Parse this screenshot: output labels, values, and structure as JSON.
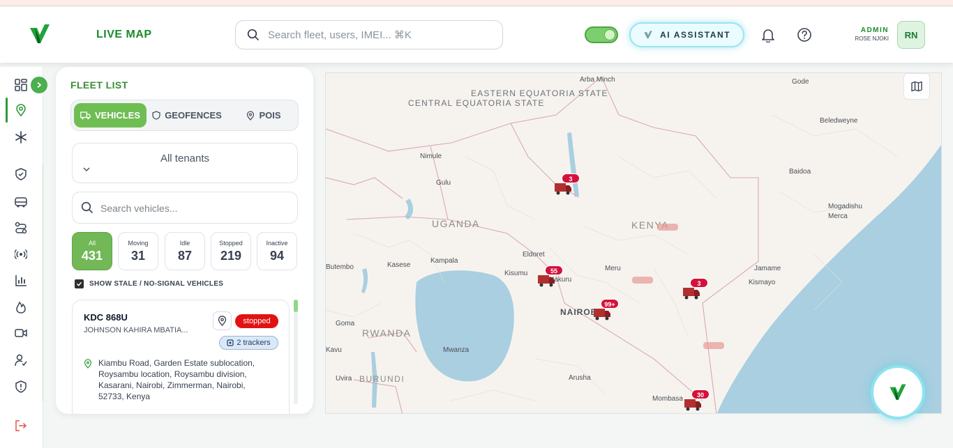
{
  "header": {
    "title": "LIVE MAP",
    "search_placeholder": "Search fleet, users, IMEI... ⌘K",
    "ai_label": "AI ASSISTANT",
    "user_role": "ADMIN",
    "user_name": "ROSE NJOKI",
    "avatar_initials": "RN"
  },
  "sidebar": {
    "icons": [
      "dashboard-icon",
      "map-pin-icon",
      "snowflake-icon",
      "shield-icon",
      "bus-icon",
      "route-icon",
      "broadcast-icon",
      "bar-chart-icon",
      "fire-icon",
      "video-icon",
      "user-check-icon",
      "alert-shield-icon",
      "logout-icon"
    ]
  },
  "fleet": {
    "title": "FLEET LIST",
    "tabs": [
      {
        "label": "VEHICLES",
        "icon": "truck-icon",
        "active": true
      },
      {
        "label": "GEOFENCES",
        "icon": "shield-icon",
        "active": false
      },
      {
        "label": "POIS",
        "icon": "pin-icon",
        "active": false
      }
    ],
    "tenant_value": "All tenants",
    "search_placeholder": "Search vehicles...",
    "stats": [
      {
        "label": "All",
        "value": "431",
        "active": true
      },
      {
        "label": "Moving",
        "value": "31",
        "active": false
      },
      {
        "label": "Idle",
        "value": "87",
        "active": false
      },
      {
        "label": "Stopped",
        "value": "219",
        "active": false
      },
      {
        "label": "Inactive",
        "value": "94",
        "active": false
      }
    ],
    "stale_label": "SHOW STALE / NO-SIGNAL VEHICLES",
    "stale_checked": true,
    "vehicle": {
      "plate": "KDC 868U",
      "driver": "JOHNSON KAHIRA MBATIA...",
      "status": "stopped",
      "trackers": "2 trackers",
      "address": "Kiambu Road, Garden Estate sublocation, Roysambu location, Roysambu division, Kasarani, Nairobi, Zimmerman, Nairobi, 52733, Kenya"
    }
  },
  "map": {
    "regions": [
      "CENTRAL EQUATORIA STATE",
      "EASTERN EQUATORIA STATE"
    ],
    "countries": [
      "UGANDA",
      "KENYA",
      "RWANDA",
      "BURUNDI"
    ],
    "capital": "NAIROBI",
    "cities": [
      "Arba Minch",
      "Gode",
      "Beledweyne",
      "Baidoa",
      "Mogadishu",
      "Merca",
      "Jamame",
      "Kismayo",
      "Nimule",
      "Gulu",
      "Eldoret",
      "Kisumu",
      "Nakuru",
      "Meru",
      "Kampala",
      "Kasese",
      "Butembo",
      "Goma",
      "Mwanza",
      "Arusha",
      "Uvira",
      "Kavu",
      "Mombasa"
    ],
    "clusters": [
      "3",
      "55",
      "99+",
      "3",
      "30"
    ]
  },
  "colors": {
    "brand": "#1a8a2e",
    "status_stopped": "#e31212",
    "cluster_badge": "#d4113b",
    "ai_glow": "#9be4ef"
  }
}
